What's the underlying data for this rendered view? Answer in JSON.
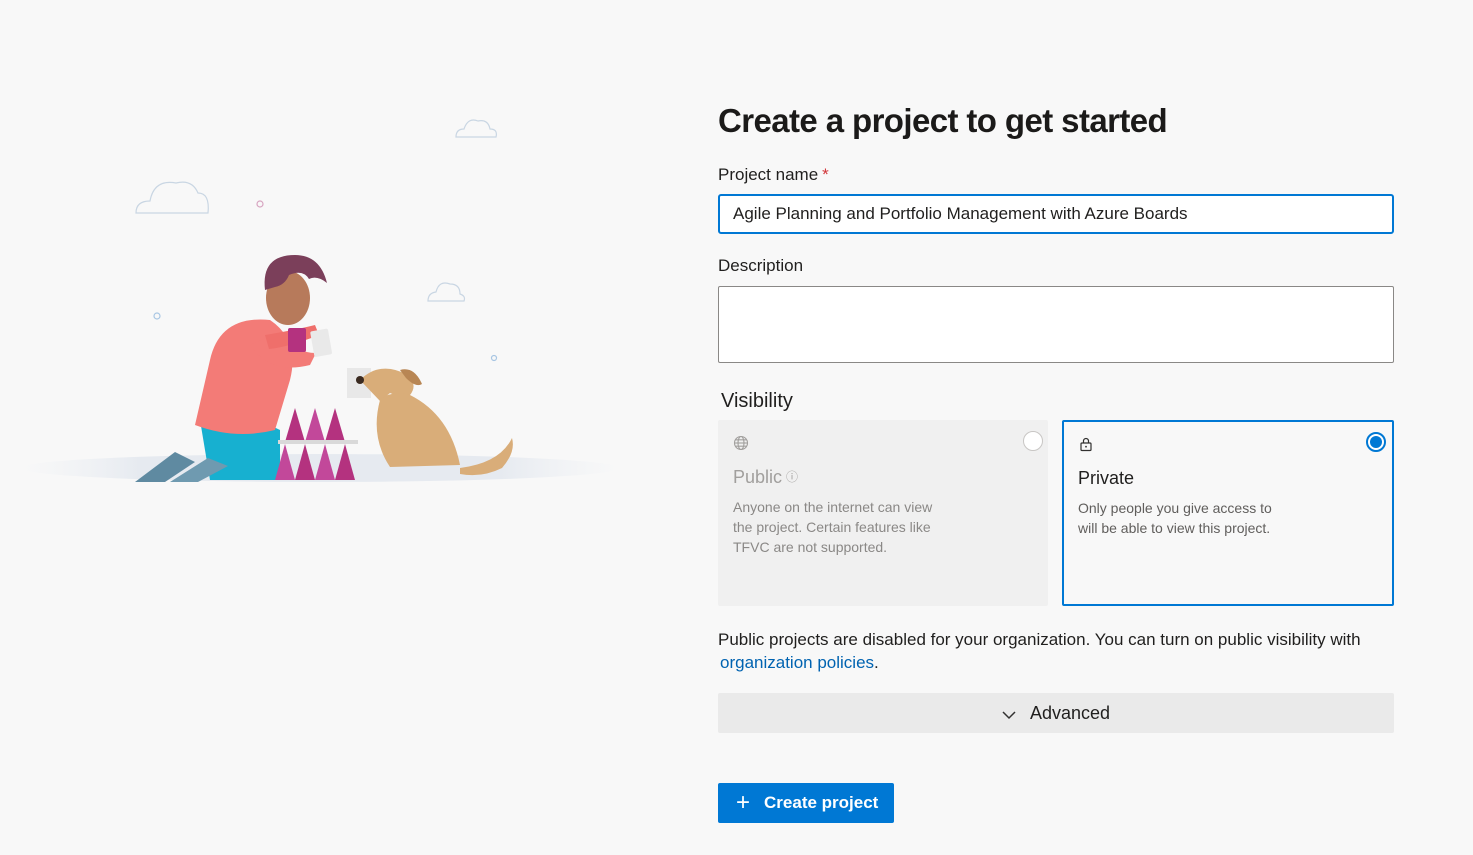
{
  "page": {
    "title": "Create a project to get started"
  },
  "form": {
    "project_name_label": "Project name",
    "required_marker": "*",
    "project_name_value": "Agile Planning and Portfolio Management with Azure Boards",
    "description_label": "Description",
    "description_value": "",
    "visibility_label": "Visibility",
    "visibility_options": [
      {
        "title": "Public",
        "description": "Anyone on the internet can view the project. Certain features like TFVC are not supported.",
        "icon": "globe-icon",
        "selected": false,
        "disabled": true
      },
      {
        "title": "Private",
        "description": "Only people you give access to will be able to view this project.",
        "icon": "lock-icon",
        "selected": true,
        "disabled": false
      }
    ],
    "notice_text": "Public projects are disabled for your organization. You can turn on public visibility with",
    "notice_link": "organization policies",
    "notice_end": ".",
    "advanced_label": "Advanced",
    "create_button_label": "Create project"
  },
  "colors": {
    "accent": "#0078d4",
    "link": "#0063b1",
    "required": "#d13438",
    "background": "#f8f8f8"
  }
}
